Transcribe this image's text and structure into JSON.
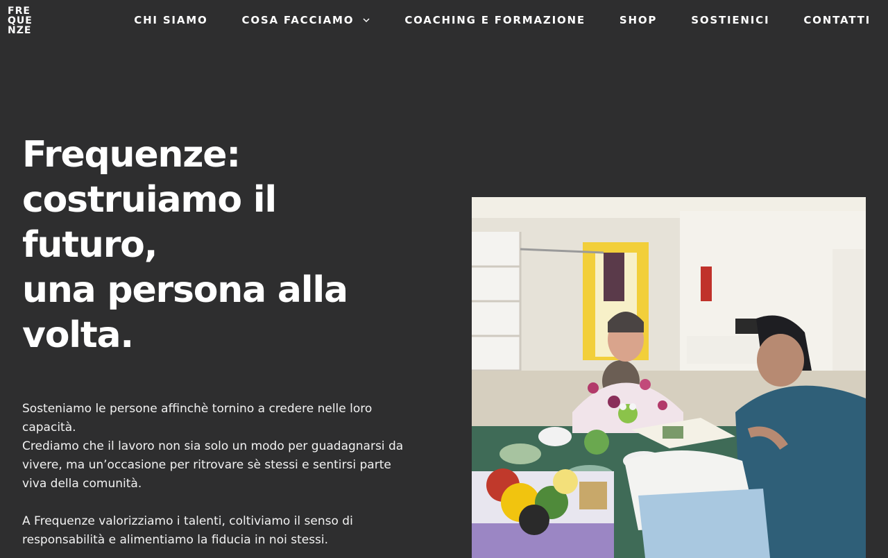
{
  "logo": {
    "lines": [
      "FRE",
      "QUE",
      "NZE"
    ]
  },
  "nav": {
    "items": [
      {
        "label": "CHI SIAMO"
      },
      {
        "label": "COSA FACCIAMO"
      },
      {
        "label": "COACHING E FORMAZIONE"
      },
      {
        "label": "SHOP"
      },
      {
        "label": "SOSTIENICI"
      },
      {
        "label": "CONTATTI"
      }
    ]
  },
  "hero": {
    "title_lines": [
      "Frequenze:",
      "costruiamo il futuro,",
      "una persona alla",
      "volta."
    ],
    "paragraphs": [
      "Sosteniamo le persone affinchè tornino a credere nelle loro capacità.",
      "Crediamo che il lavoro non sia solo un modo per guadagnarsi da vivere, ma un’occasione per ritrovare sè stessi e sentirsi parte viva della comunità.",
      "A Frequenze valorizziamo i talenti, coltiviamo il senso di responsabilità e alimentiamo la fiducia in noi stessi."
    ]
  },
  "colors": {
    "background": "#2e2e2f",
    "text": "#ffffff"
  },
  "icons": {
    "dropdown": "chevron-down-icon"
  }
}
